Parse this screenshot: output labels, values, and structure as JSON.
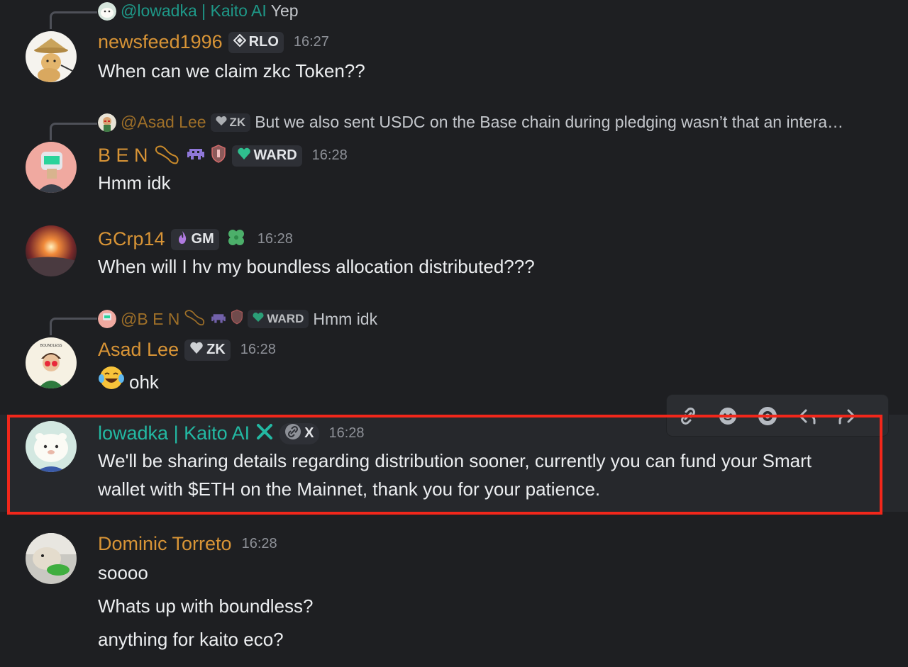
{
  "colors": {
    "background": "#1e1f22",
    "highlight_border": "#f2271b",
    "username_orange": "#d89436",
    "username_teal": "#23b9a3"
  },
  "messages": [
    {
      "reply": {
        "name": "@lowadka | Kaito AI",
        "text": "Yep"
      },
      "username": "newsfeed1996",
      "tag": "RLO",
      "time": "16:27",
      "lines": [
        "When can we claim zkc Token??"
      ]
    },
    {
      "reply": {
        "name": "@Asad Lee",
        "tag": "ZK",
        "text": "But we also sent USDC on the Base chain during pledging wasn’t that an intera…"
      },
      "username": "B E N",
      "tag": "WARD",
      "time": "16:28",
      "lines": [
        "Hmm idk"
      ]
    },
    {
      "username": "GCrp14",
      "tag": "GM",
      "time": "16:28",
      "lines": [
        "When will I hv my boundless allocation distributed???"
      ]
    },
    {
      "reply": {
        "name": "@B E N",
        "tag": "WARD",
        "text": "Hmm idk"
      },
      "username": "Asad Lee",
      "tag": "ZK",
      "time": "16:28",
      "lines": [
        "ohk"
      ],
      "avatar_caption": "BOUNDLESS"
    },
    {
      "username": "lowadka | Kaito AI",
      "tag": "X",
      "time": "16:28",
      "lines": [
        "We'll be sharing details regarding distribution sooner, currently you can fund your Smart",
        "wallet with $ETH on the Mainnet, thank you for your patience."
      ]
    },
    {
      "username": "Dominic Torreto",
      "time": "16:28",
      "lines": [
        "soooo",
        "Whats up with boundless?",
        "anything for kaito eco?"
      ]
    }
  ],
  "toolbar_icons": [
    "link-icon",
    "add-reaction-icon",
    "super-reaction-icon",
    "reply-icon",
    "forward-icon"
  ]
}
